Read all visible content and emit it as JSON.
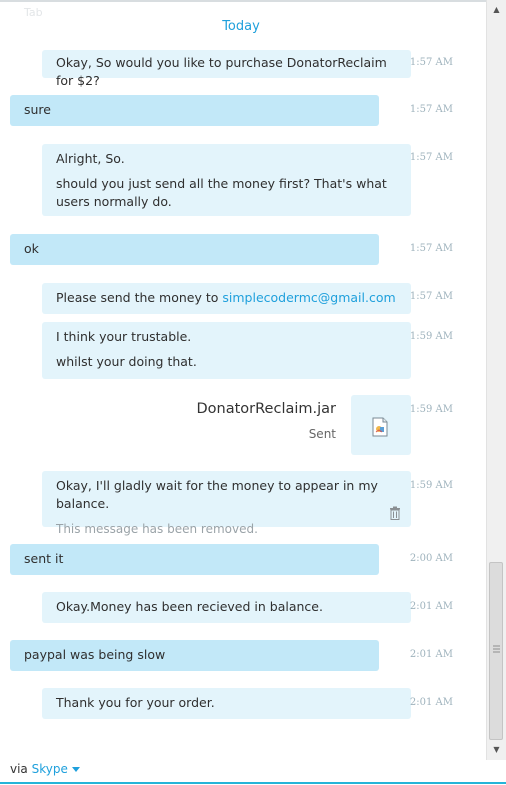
{
  "window": {
    "ghost_text": "Tab"
  },
  "conversation": {
    "day_header": "Today",
    "messages": [
      {
        "dir": "out",
        "lines": [
          "Okay, So would you like to purchase DonatorReclaim for $2?"
        ],
        "time": "1:57 AM"
      },
      {
        "dir": "in",
        "lines": [
          "sure"
        ],
        "time": "1:57 AM"
      },
      {
        "dir": "out",
        "lines": [
          "Alright, So.",
          "should you just send all the money first? That's what users normally do."
        ],
        "time": "1:57 AM"
      },
      {
        "dir": "in",
        "lines": [
          "ok"
        ],
        "time": "1:57 AM"
      },
      {
        "dir": "out",
        "prefix": "Please send the money to ",
        "link": "simplecodermc@gmail.com",
        "time": "1:57 AM"
      },
      {
        "dir": "out",
        "lines": [
          "I think your trustable.",
          "whilst your doing that."
        ],
        "time": "1:59 AM"
      },
      {
        "dir": "out",
        "kind": "file",
        "file_name": "DonatorReclaim.jar",
        "status": "Sent",
        "time": "1:59 AM"
      },
      {
        "dir": "out",
        "lines": [
          "Okay, I'll gladly wait for the money to appear in my balance."
        ],
        "removed_note": "This message has been removed.",
        "time": "1:59 AM"
      },
      {
        "dir": "in",
        "lines": [
          "sent it"
        ],
        "time": "2:00 AM"
      },
      {
        "dir": "out",
        "lines": [
          "Okay.Money has been recieved in balance."
        ],
        "time": "2:01 AM"
      },
      {
        "dir": "in",
        "lines": [
          "paypal was being slow"
        ],
        "time": "2:01 AM"
      },
      {
        "dir": "out",
        "lines": [
          "Thank you for your order."
        ],
        "time": "2:01 AM"
      }
    ]
  },
  "footer": {
    "via": "via ",
    "service": "Skype"
  },
  "icons": {
    "file": "file-icon",
    "trash": "trash-icon",
    "dropdown": "chevron-down-icon"
  },
  "colors": {
    "accent": "#1fa0dc",
    "incoming_bubble": "#c2e8f8",
    "outgoing_bubble": "#e3f4fb"
  }
}
